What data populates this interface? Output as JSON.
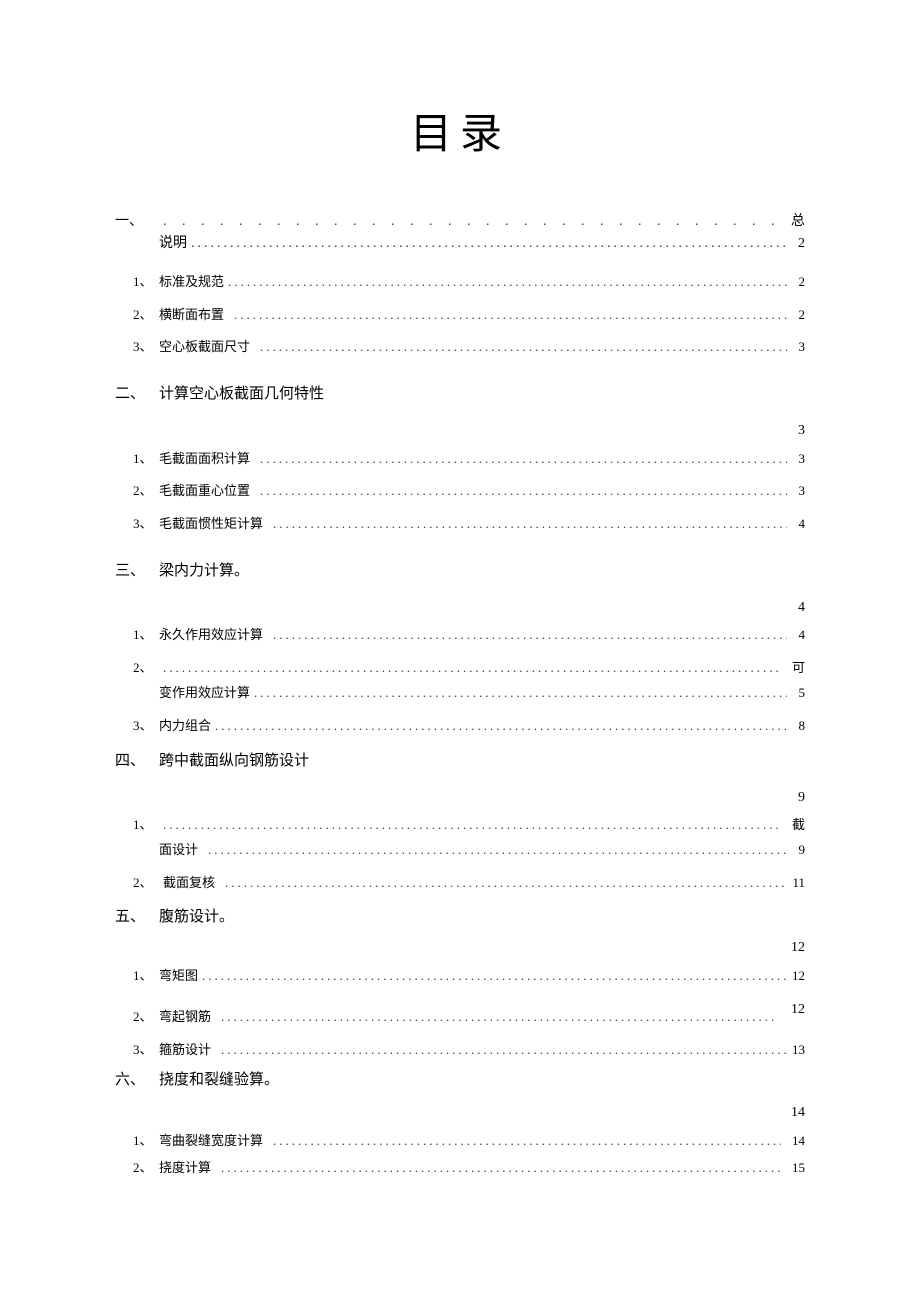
{
  "title": "目录",
  "sections": {
    "s1": {
      "num": "一、",
      "trail": "总",
      "line2_label": "说明",
      "line2_page": "2",
      "items": [
        {
          "num": "1、",
          "label": "标准及规范",
          "page": "2"
        },
        {
          "num": "2、",
          "label": "横断面布置",
          "page": "2"
        },
        {
          "num": "3、",
          "label": "空心板截面尺寸",
          "page": "3"
        }
      ]
    },
    "s2": {
      "num": "二、",
      "label": "计算空心板截面几何特性",
      "page": "3",
      "items": [
        {
          "num": "1、",
          "label": "毛截面面积计算",
          "page": "3"
        },
        {
          "num": "2、",
          "label": "毛截面重心位置",
          "page": "3"
        },
        {
          "num": "3、",
          "label": "毛截面惯性矩计算",
          "page": "4"
        }
      ]
    },
    "s3": {
      "num": "三、",
      "label": "梁内力计算。",
      "page": "4",
      "items": [
        {
          "num": "1、",
          "label": "永久作用效应计算",
          "page": "4"
        },
        {
          "num": "2、",
          "trail": "可",
          "line2_label": "变作用效应计算",
          "line2_page": "5"
        },
        {
          "num": "3、",
          "label": "内力组合",
          "page": "8"
        }
      ]
    },
    "s4": {
      "num": "四、",
      "label": "跨中截面纵向钢筋设计",
      "page": "9",
      "items": [
        {
          "num": "1、",
          "trail": "截",
          "line2_label": "面设计",
          "line2_page": "9"
        },
        {
          "num": "2、",
          "label": "截面复核",
          "page": "11"
        }
      ]
    },
    "s5": {
      "num": "五、",
      "label": "腹筋设计。",
      "page": "12",
      "items": [
        {
          "num": "1、",
          "label": "弯矩图",
          "page": "12"
        },
        {
          "num": "2、",
          "label": "弯起钢筋",
          "page": "12"
        },
        {
          "num": "3、",
          "label": "箍筋设计",
          "page": "13"
        }
      ]
    },
    "s6": {
      "num": "六、",
      "label": "挠度和裂缝验算。",
      "page": "14",
      "items": [
        {
          "num": "1、",
          "label": "弯曲裂缝宽度计算",
          "page": "14"
        },
        {
          "num": "2、",
          "label": "挠度计算",
          "page": "15"
        }
      ]
    }
  }
}
